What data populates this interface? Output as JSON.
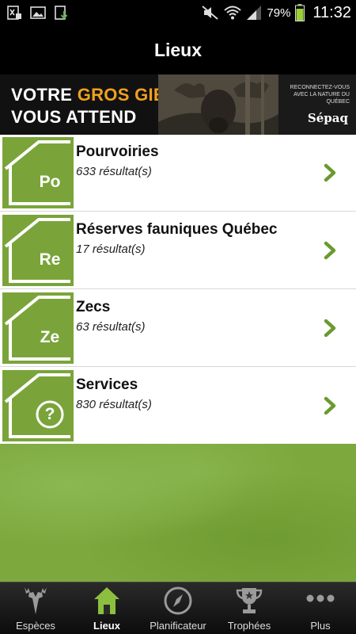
{
  "status_bar": {
    "battery_percent": "79%",
    "time": "11:32",
    "icons": [
      "excel-notification-icon",
      "image-notification-icon",
      "download-notification-icon",
      "mute-icon",
      "wifi-icon",
      "signal-icon",
      "battery-icon"
    ]
  },
  "header": {
    "title": "Lieux"
  },
  "ad_banner": {
    "line1_prefix": "VOTRE ",
    "line1_highlight": "GROS GIBIER",
    "line2": "VOUS ATTEND",
    "tagline": "RECONNECTEZ-VOUS AVEC LA NATURE DU QUÉBEC",
    "brand": "Sépaq",
    "highlight_color": "#f0a020"
  },
  "places": [
    {
      "abbr": "Po",
      "title": "Pourvoiries",
      "subtitle": "633 résultat(s)"
    },
    {
      "abbr": "Re",
      "title": "Réserves fauniques Québec",
      "subtitle": "17 résultat(s)"
    },
    {
      "abbr": "Ze",
      "title": "Zecs",
      "subtitle": "63 résultat(s)"
    },
    {
      "abbr": "?",
      "title": "Services",
      "subtitle": "830 résultat(s)"
    }
  ],
  "tabs": [
    {
      "label": "Espèces",
      "icon": "deer-head-icon",
      "active": false
    },
    {
      "label": "Lieux",
      "icon": "house-icon",
      "active": true
    },
    {
      "label": "Planificateur",
      "icon": "compass-icon",
      "active": false
    },
    {
      "label": "Trophées",
      "icon": "trophy-icon",
      "active": false
    },
    {
      "label": "Plus",
      "icon": "more-dots-icon",
      "active": false
    }
  ],
  "colors": {
    "accent_green": "#7aa43a",
    "chevron_green": "#6a9a2e",
    "active_tab_green": "#8cbf3f"
  }
}
